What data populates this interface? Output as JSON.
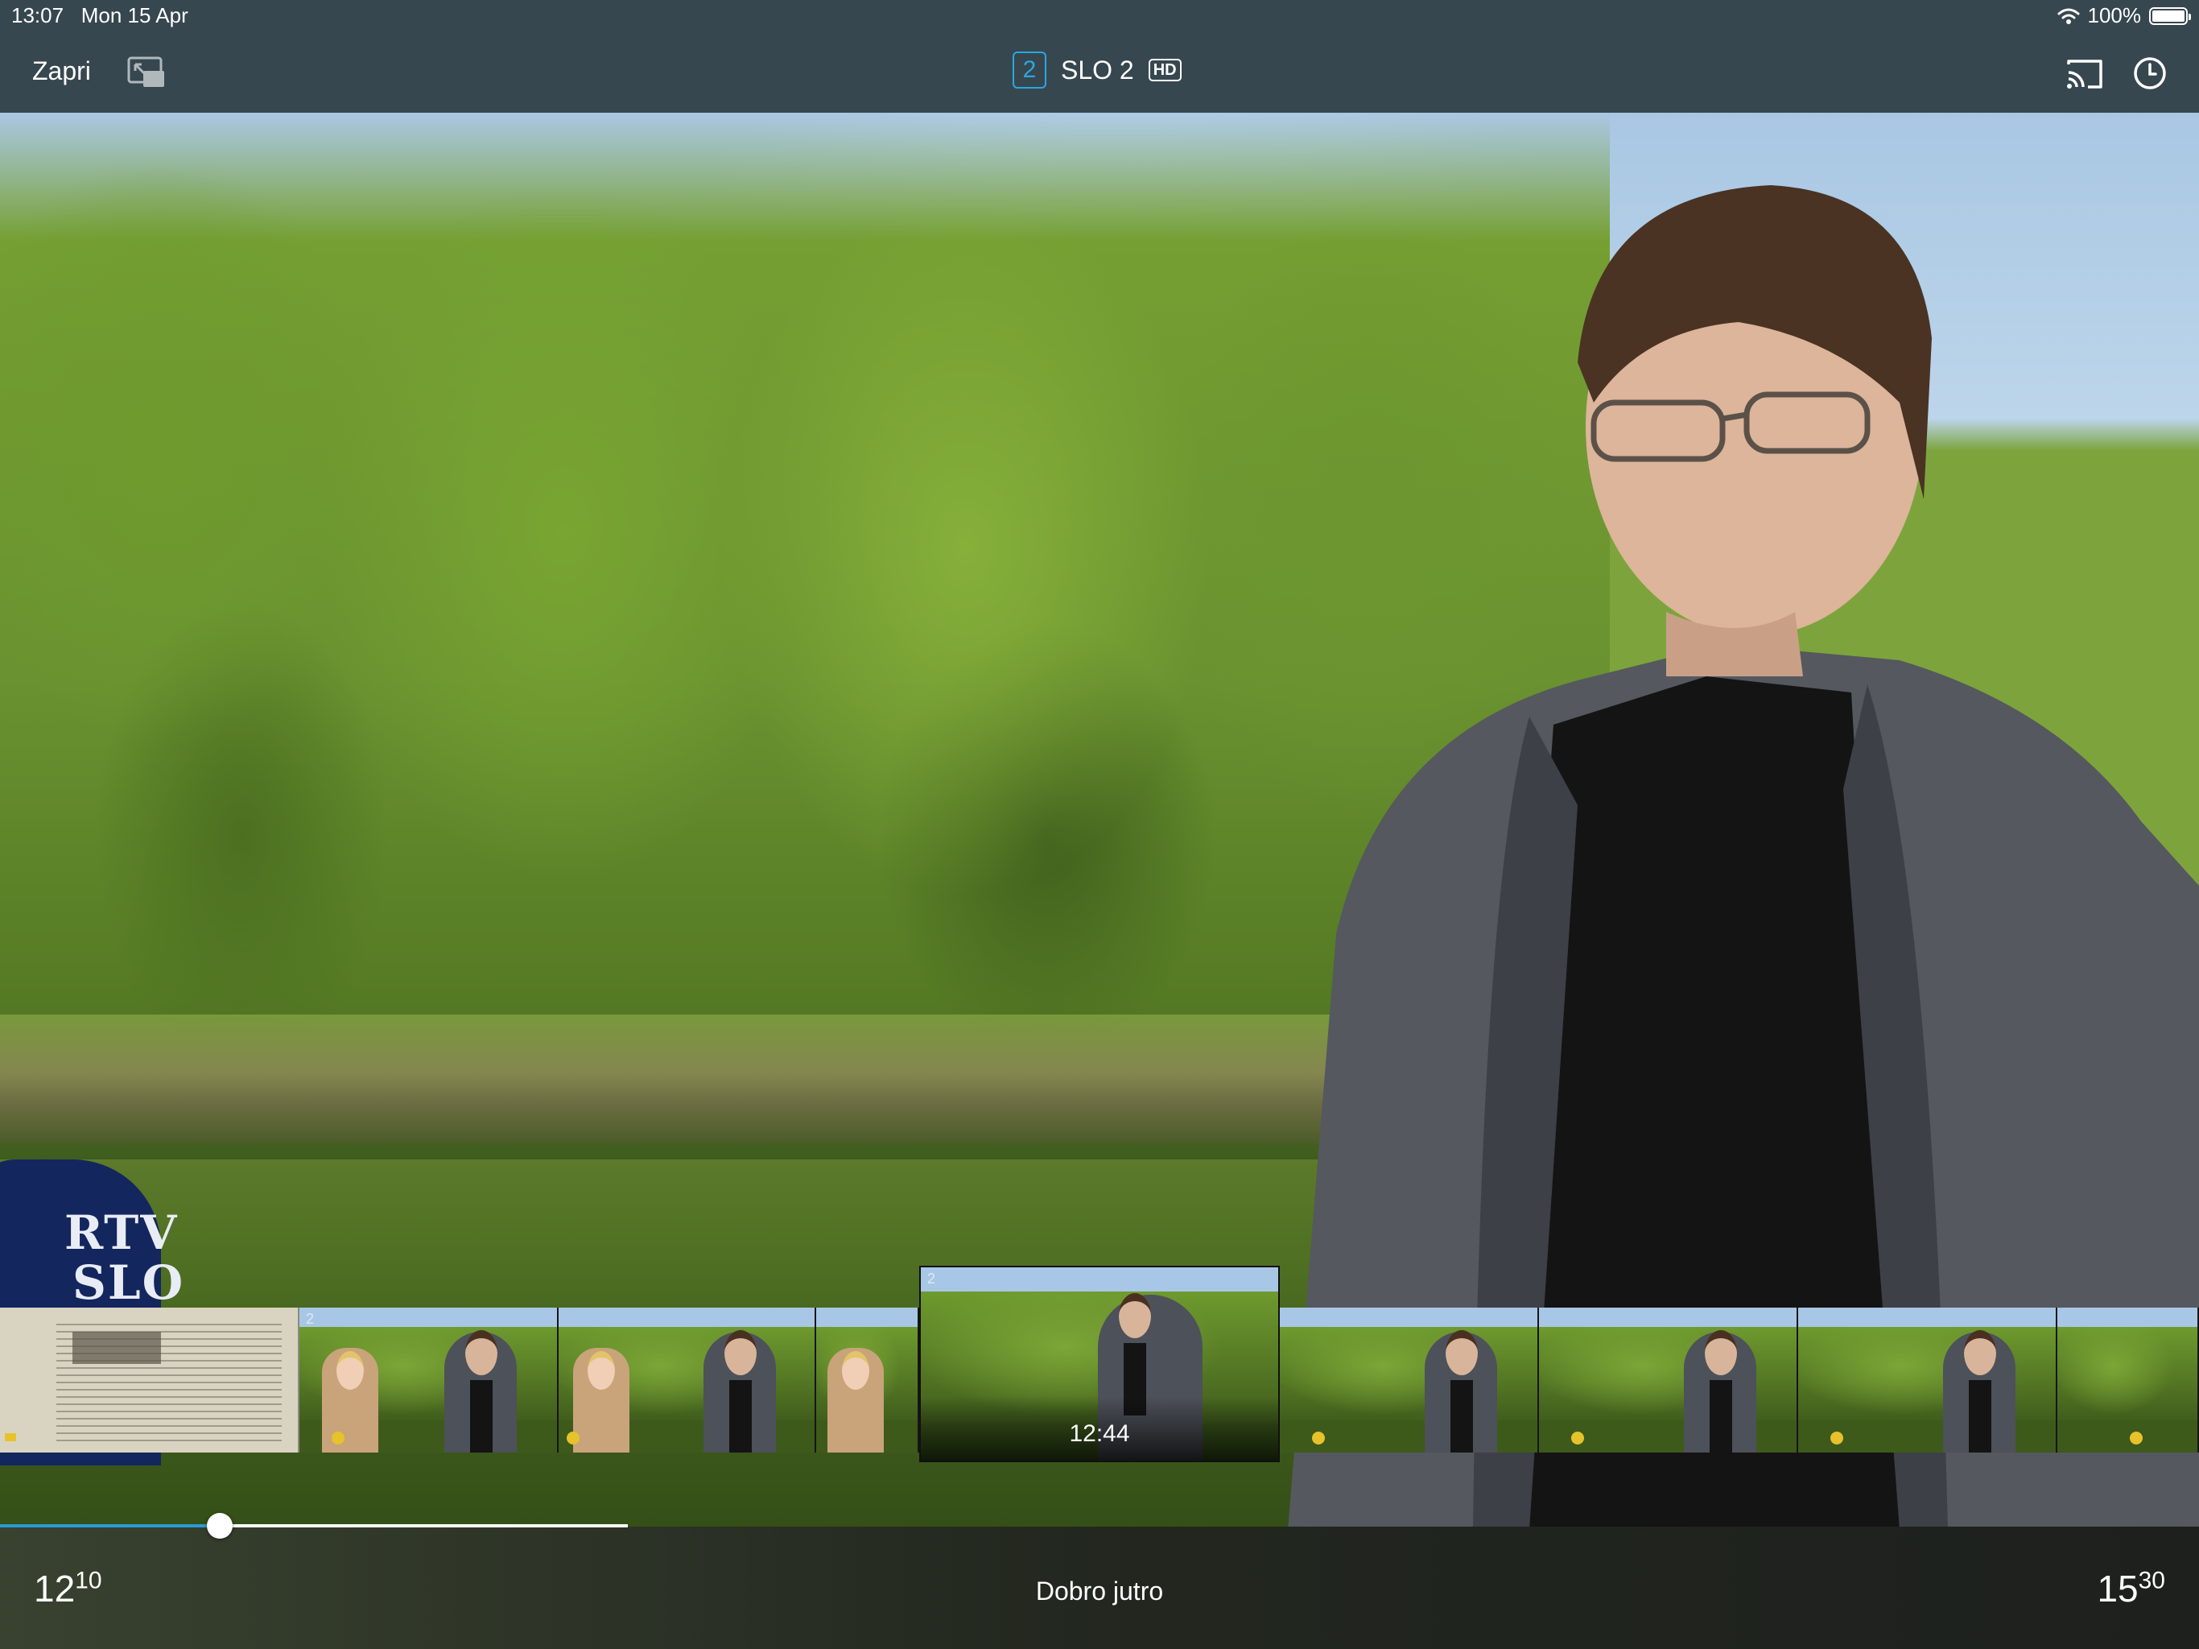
{
  "status_bar": {
    "time": "13:07",
    "date": "Mon 15 Apr",
    "battery": "100%",
    "wifi_icon": "wifi-icon",
    "battery_icon": "battery-icon"
  },
  "top_bar": {
    "close_label": "Zapri",
    "channel_number": "2",
    "channel_name": "SLO 2",
    "hd_badge": "HD",
    "icons": [
      "picture-in-picture-icon",
      "cast-icon",
      "clock-icon"
    ],
    "background_color": "#37474f",
    "accent_color": "#29a8e0"
  },
  "video": {
    "microphone_label_line1": "RTV",
    "microphone_label_line2": "SLO"
  },
  "thumbnail_strip": {
    "active_time": "12:44",
    "thumbnails": [
      {
        "kind": "document"
      },
      {
        "kind": "interview"
      },
      {
        "kind": "interview"
      },
      {
        "kind": "interview"
      },
      {
        "kind": "active"
      },
      {
        "kind": "portrait"
      },
      {
        "kind": "portrait"
      },
      {
        "kind": "portrait"
      },
      {
        "kind": "portrait"
      }
    ],
    "channel_watermark": "2"
  },
  "timeline": {
    "progress_fraction": 0.35,
    "track_color": "#ffffff",
    "fill_color": "#2a9bd3"
  },
  "bottom_bar": {
    "start_hour": "12",
    "start_minute": "10",
    "program_title": "Dobro jutro",
    "end_hour": "15",
    "end_minute": "30"
  }
}
